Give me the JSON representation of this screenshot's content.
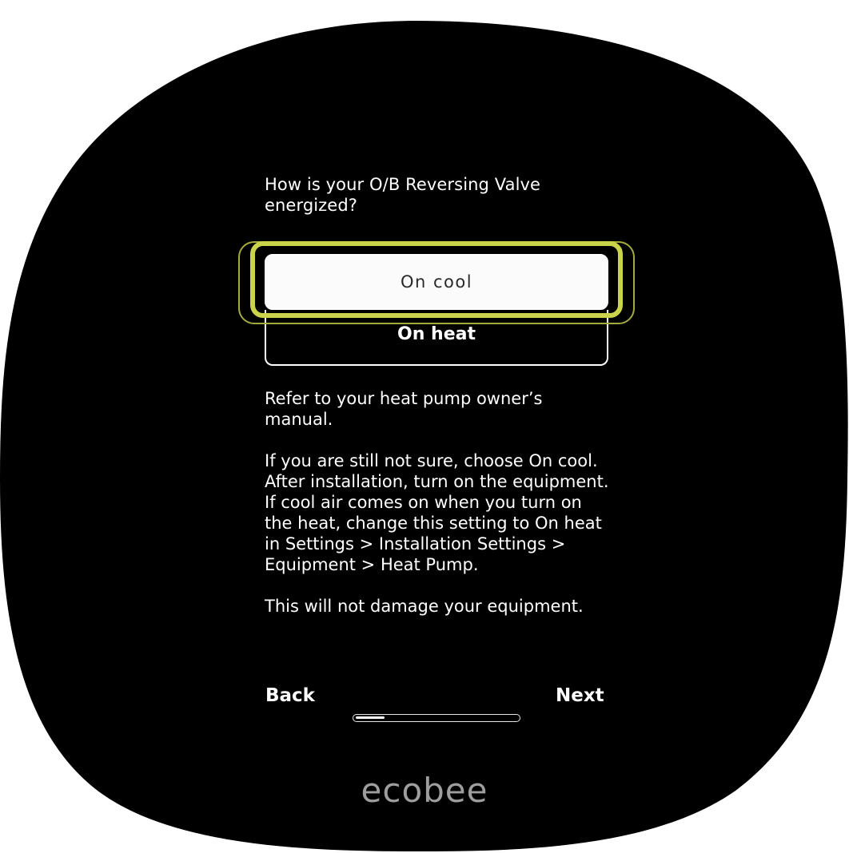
{
  "colors": {
    "bezel": "#000000",
    "background": "#ffffff",
    "text": "#ffffff",
    "selected_fill": "#fbfbfb",
    "focus_ring": "#c9d44a",
    "brand_text": "#9e9e9e"
  },
  "screen": {
    "question": "How is your O/B Reversing Valve energized?",
    "options": [
      {
        "label": "On cool",
        "selected": true
      },
      {
        "label": "On heat",
        "selected": false
      }
    ],
    "help": [
      "Refer to your heat pump owner’s manual.",
      "If you are still not sure, choose On cool.  After installation, turn on the equipment.  If cool air comes on when you turn on the heat, change this setting to On heat in Settings > Installation Settings > Equipment > Heat Pump.",
      "This will not damage your equipment."
    ],
    "nav": {
      "back_label": "Back",
      "next_label": "Next"
    },
    "progress": 0.18
  },
  "brand": "ecobee"
}
